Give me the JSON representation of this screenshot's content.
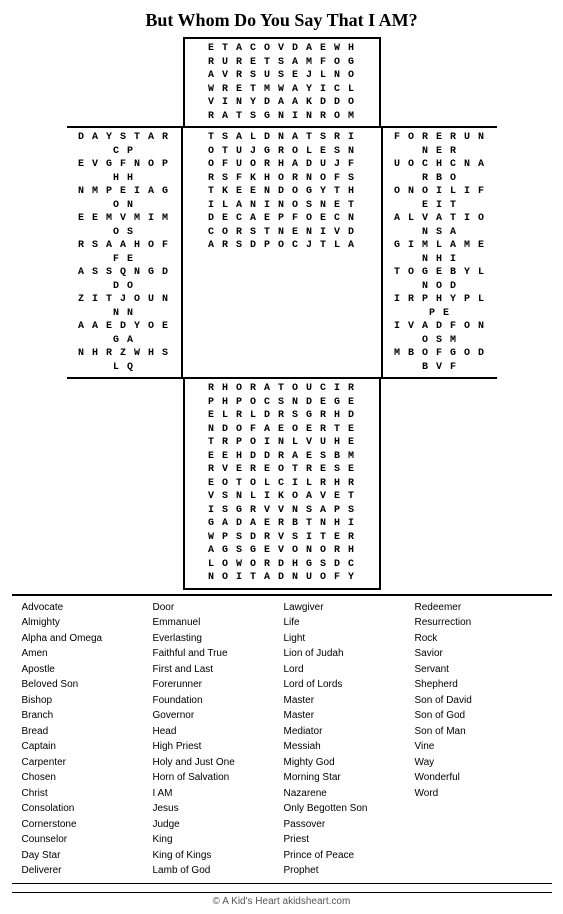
{
  "title": "But Whom Do You Say That I AM?",
  "topRows": [
    "E T A C O V D A E W H",
    "R U R E T S A M F O G",
    "A V R S U S E J L N O",
    "W R E T M W A Y I C L",
    "V I N Y D A A K D D O",
    "R A T S G N I N R O M"
  ],
  "middleRows": [
    "D A Y S T A R C P T S A L D N A T S R I F O R E R U N N E R",
    "E V G F N O P H H O T U J G R O L E S N U O C H C N A R B O",
    "N M P E I A G O N O F U O R H A D U J F O N O I L I F E I T",
    "E E M V M I M O S R S F K H O R N O F S A L V A T I O N S A",
    "R S A A H O F F E T K E E N D O G Y T H G I M L A M E N H I",
    "A S S Q N G D D O I L A N I N O S N E T T O G E B Y L N O D",
    "Z I T J O U N N N D E C A E P F O E C N I R P H Y P L P E",
    "A A E D Y O E G A C O R S T N E N I V D I V A D F O N O S M",
    "N H R Z W H S L Q A R S D P O C J T L A M B O F G O D B V F"
  ],
  "bottomRows": [
    "R H O R A T O U C I R",
    "P H P O C S N D E G E",
    "E L R L D R S G R H D",
    "N D O F A E O E R T E",
    "T R P O I N L V U H E",
    "E E H D D R A E S B M",
    "R V E R E O T R E S E",
    "E O T O L C I L R H R",
    "V S N L I K O A V E T",
    "I S G R V V N S A P S",
    "G A D A E R B T N H I",
    "W P S D R V S I T E R",
    "A G S G E V O N O R H",
    "L O W O R D H G S D C",
    "N O I T A D N U O F Y"
  ],
  "wordColumns": [
    [
      "Advocate",
      "Almighty",
      "Alpha and Omega",
      "Amen",
      "Apostle",
      "Beloved Son",
      "Bishop",
      "Branch",
      "Bread",
      "Captain",
      "Carpenter",
      "Chosen",
      "Christ",
      "Consolation",
      "Cornerstone",
      "Counselor",
      "Day Star",
      "Deliverer"
    ],
    [
      "Door",
      "Emmanuel",
      "Everlasting",
      "Faithful and True",
      "First and Last",
      "Forerunner",
      "Foundation",
      "Governor",
      "Head",
      "High Priest",
      "Holy and Just One",
      "Horn of Salvation",
      "I AM",
      "Jesus",
      "Judge",
      "King",
      "King of Kings",
      "Lamb of God"
    ],
    [
      "Lawgiver",
      "Life",
      "Light",
      "Lion of Judah",
      "Lord",
      "Lord of Lords",
      "Master",
      "Master",
      "Mediator",
      "Messiah",
      "Mighty God",
      "Morning Star",
      "Nazarene",
      "Only Begotten Son",
      "Passover",
      "Priest",
      "Prince of Peace",
      "Prophet"
    ],
    [
      "Redeemer",
      "Resurrection",
      "Rock",
      "Savior",
      "Servant",
      "Shepherd",
      "Son of David",
      "Son of God",
      "Son of Man",
      "Vine",
      "Way",
      "Wonderful",
      "Word"
    ]
  ],
  "footer": "© A Kid's Heart    akidsheart.com"
}
